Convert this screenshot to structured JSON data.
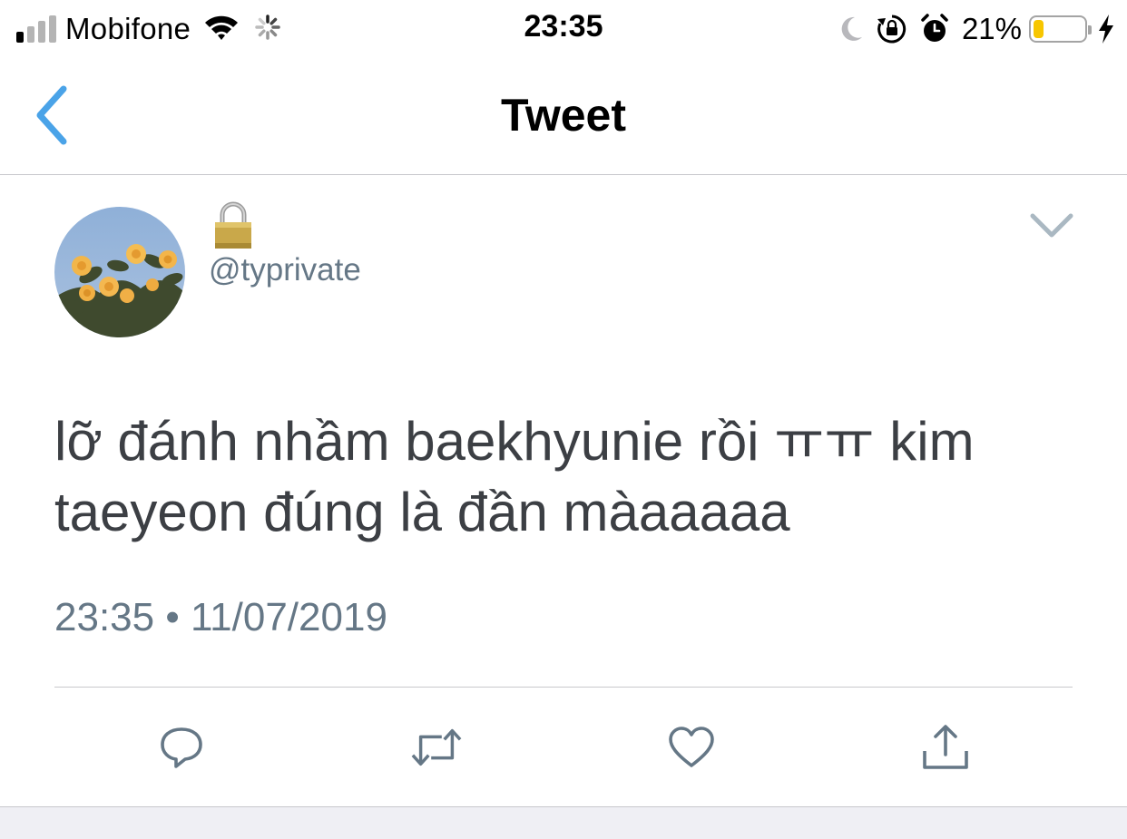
{
  "status_bar": {
    "carrier": "Mobifone",
    "time": "23:35",
    "battery_percent": "21%",
    "battery_level": 0.21,
    "signal_bars_active": 1,
    "signal_bars_total": 4,
    "icons": [
      "signal-icon",
      "wifi-icon",
      "activity-spinner-icon",
      "moon-icon",
      "rotation-lock-icon",
      "alarm-icon",
      "battery-icon",
      "charging-bolt-icon"
    ]
  },
  "nav": {
    "title": "Tweet",
    "back_icon": "chevron-left-icon"
  },
  "tweet": {
    "display_name_icon": "lock-icon",
    "handle": "@typrivate",
    "text": "lỡ đánh nhầm baekhyunie rồi ㅠㅠ kim taeyeon đúng là đần màaaaaa",
    "timestamp": "23:35 • 11/07/2019",
    "menu_icon": "chevron-down-icon"
  },
  "actions": [
    {
      "name": "reply",
      "icon": "reply-icon"
    },
    {
      "name": "retweet",
      "icon": "retweet-icon"
    },
    {
      "name": "like",
      "icon": "heart-icon"
    },
    {
      "name": "share",
      "icon": "share-icon"
    }
  ],
  "colors": {
    "accent": "#4aa3e8",
    "secondary_text": "#657786",
    "body_text": "#3c3f44",
    "battery_fill": "#f7c600",
    "divider": "#c8c8cc"
  }
}
